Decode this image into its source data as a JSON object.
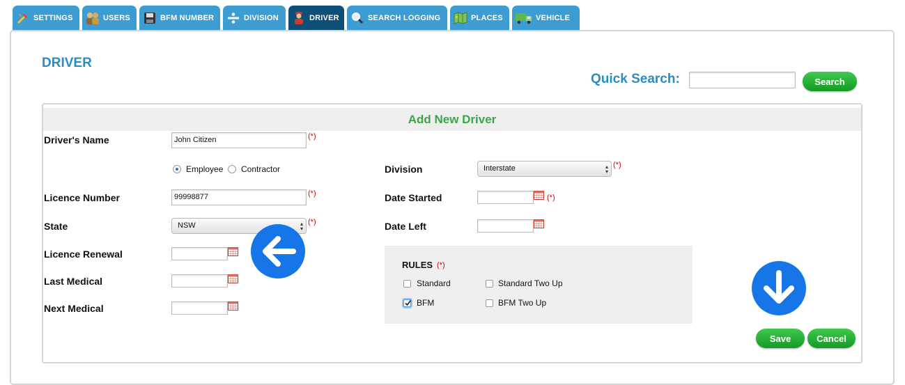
{
  "tabs": [
    {
      "label": "SETTINGS",
      "icon": "tools-icon"
    },
    {
      "label": "USERS",
      "icon": "users-icon"
    },
    {
      "label": "BFM NUMBER",
      "icon": "floppy-icon"
    },
    {
      "label": "DIVISION",
      "icon": "divide-icon"
    },
    {
      "label": "DRIVER",
      "icon": "driver-icon",
      "active": true
    },
    {
      "label": "SEARCH LOGGING",
      "icon": "magnifier-icon"
    },
    {
      "label": "PLACES",
      "icon": "map-icon"
    },
    {
      "label": "VEHICLE",
      "icon": "truck-icon"
    }
  ],
  "page": {
    "title": "DRIVER"
  },
  "quick_search": {
    "label": "Quick Search:",
    "value": "",
    "button": "Search"
  },
  "form": {
    "heading": "Add New Driver",
    "required_mark": "(*)",
    "drivers_name": {
      "label": "Driver's Name",
      "value": "John Citizen"
    },
    "employment": {
      "options": [
        "Employee",
        "Contractor"
      ],
      "selected": "Employee"
    },
    "licence_number": {
      "label": "Licence Number",
      "value": "99998877"
    },
    "state": {
      "label": "State",
      "value": "NSW"
    },
    "licence_renewal": {
      "label": "Licence Renewal",
      "value": ""
    },
    "last_medical": {
      "label": "Last Medical",
      "value": ""
    },
    "next_medical": {
      "label": "Next Medical",
      "value": ""
    },
    "division": {
      "label": "Division",
      "value": "Interstate"
    },
    "date_started": {
      "label": "Date Started",
      "value": ""
    },
    "date_left": {
      "label": "Date Left",
      "value": ""
    },
    "rules": {
      "label": "RULES",
      "options": [
        {
          "label": "Standard",
          "checked": false
        },
        {
          "label": "Standard Two Up",
          "checked": false
        },
        {
          "label": "BFM",
          "checked": true
        },
        {
          "label": "BFM Two Up",
          "checked": false
        }
      ]
    },
    "save_label": "Save",
    "cancel_label": "Cancel"
  },
  "colors": {
    "tab": "#3d9cd2",
    "tab_active": "#0e4f78",
    "title": "#2a8cc4",
    "heading": "#3aa64a",
    "button": "#1e9f2c",
    "arrow": "#1676e8",
    "required": "#d40000"
  }
}
